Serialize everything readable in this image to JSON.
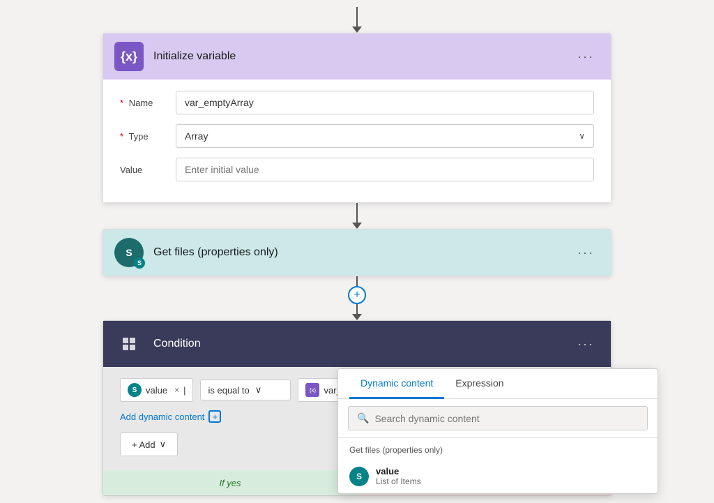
{
  "top_arrow": "↓",
  "cards": {
    "init_var": {
      "icon_label": "{x}",
      "title": "Initialize variable",
      "more_label": "···",
      "fields": {
        "name_label": "Name",
        "name_required": "*",
        "name_value": "var_emptyArray",
        "type_label": "Type",
        "type_required": "*",
        "type_value": "Array",
        "value_label": "Value",
        "value_placeholder": "Enter initial value"
      }
    },
    "get_files": {
      "icon_initials": "S",
      "title": "Get files (properties only)",
      "more_label": "···"
    },
    "condition": {
      "icon_label": "⊞",
      "title": "Condition",
      "more_label": "···",
      "token1_label": "value",
      "token1_close": "×",
      "token1_cursor": "|",
      "operator_label": "is equal to",
      "token2_label": "var_emp...",
      "token2_close": "×",
      "add_dynamic_label": "Add dynamic content",
      "add_btn_label": "+ Add"
    }
  },
  "popup": {
    "tab_dynamic": "Dynamic content",
    "tab_expression": "Expression",
    "search_placeholder": "Search dynamic content",
    "section_label": "Get files (properties only)",
    "items": [
      {
        "icon": "S",
        "name": "value",
        "sub": "List of Items"
      }
    ]
  },
  "icons": {
    "search": "🔍",
    "plus": "+",
    "arrow": "↓",
    "chevron": "∨"
  }
}
